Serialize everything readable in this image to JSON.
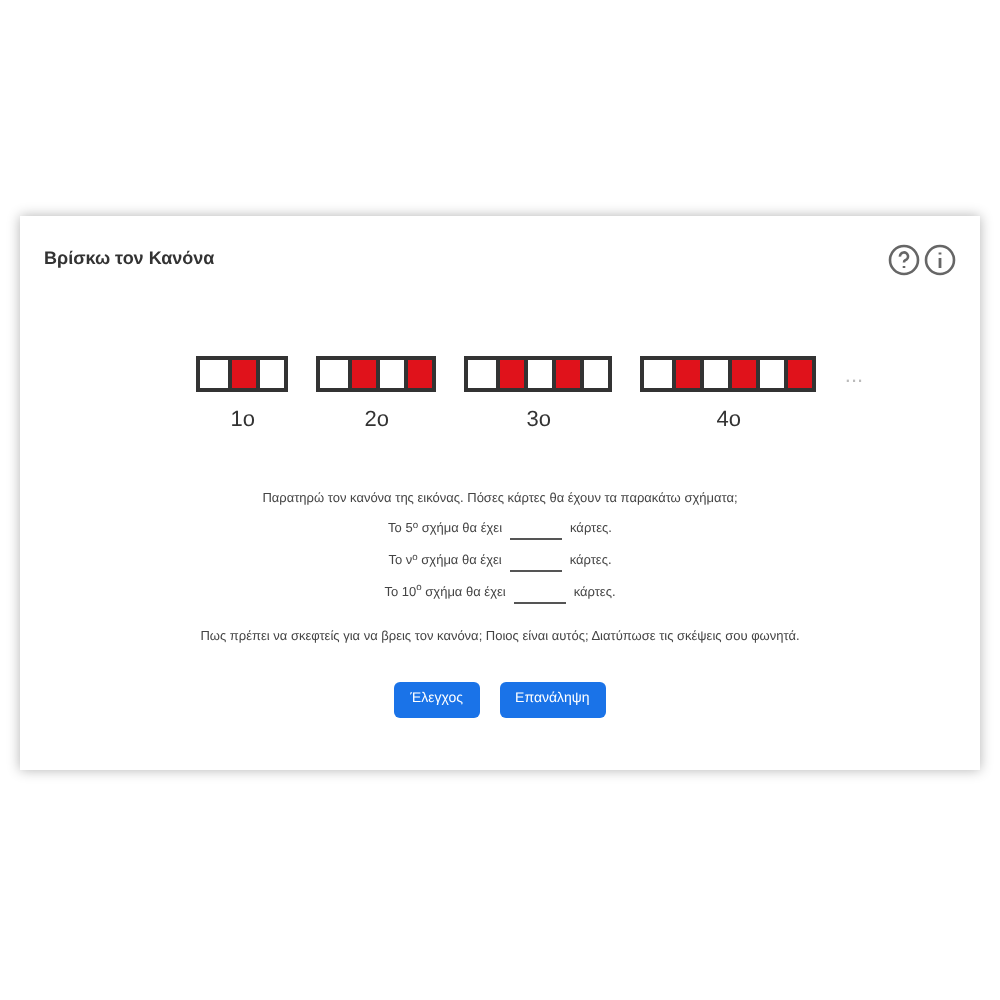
{
  "card": {
    "title": "Βρίσκω τον Κανόνα"
  },
  "figures": [
    {
      "label": "1ο",
      "cells": [
        {
          "filled": false
        },
        {
          "filled": true
        },
        {
          "filled": false
        }
      ]
    },
    {
      "label": "2ο",
      "cells": [
        {
          "filled": false
        },
        {
          "filled": true
        },
        {
          "filled": false
        },
        {
          "filled": true
        }
      ]
    },
    {
      "label": "3ο",
      "cells": [
        {
          "filled": false
        },
        {
          "filled": true
        },
        {
          "filled": false
        },
        {
          "filled": true
        },
        {
          "filled": false
        }
      ]
    },
    {
      "label": "4ο",
      "cells": [
        {
          "filled": false
        },
        {
          "filled": true
        },
        {
          "filled": false
        },
        {
          "filled": true
        },
        {
          "filled": false
        },
        {
          "filled": true
        }
      ]
    }
  ],
  "ellipsis": "...",
  "instruction": "Παρατηρώ τον κανόνα της εικόνας. Πόσες κάρτες θα έχουν τα παρακάτω σχήματα;",
  "questions": [
    {
      "before": "Το 5$^{ο}$ σχήμα θα έχει",
      "after": "κάρτες."
    },
    {
      "before": "Το ν$^{ο}$ σχήμα θα έχει",
      "after": "κάρτες."
    },
    {
      "before": "Το 10$^{ο}$ σχήμα θα έχει",
      "after": "κάρτες."
    }
  ],
  "prompt": "Πως πρέπει να σκεφτείς για να βρεις τον κανόνα; Ποιος είναι αυτός; Διατύπωσε τις σκέψεις σου φωνητά.",
  "buttons": [
    "Έλεγχος",
    "Επανάληψη"
  ]
}
